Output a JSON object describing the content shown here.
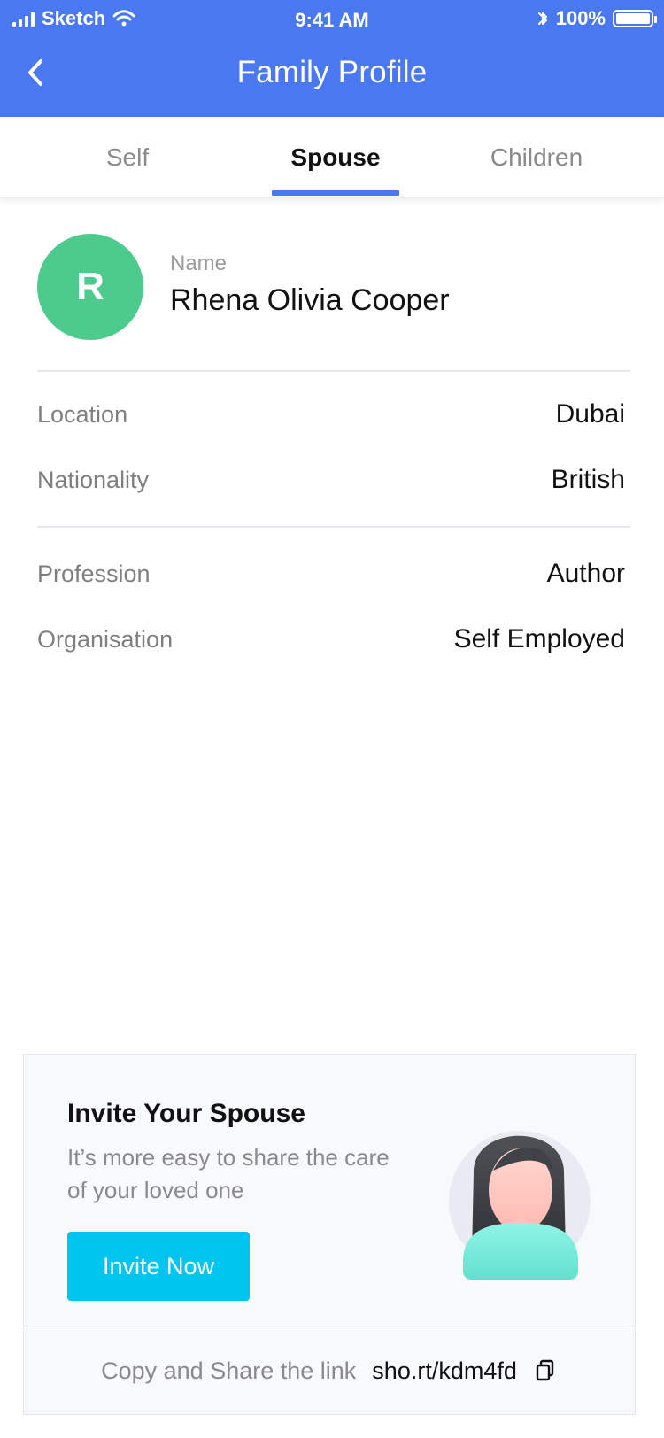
{
  "status_bar": {
    "carrier": "Sketch",
    "time": "9:41 AM",
    "battery": "100%"
  },
  "header": {
    "title": "Family Profile",
    "back_icon": "chevron-left-icon"
  },
  "tabs": [
    {
      "label": "Self"
    },
    {
      "label": "Spouse"
    },
    {
      "label": "Children"
    }
  ],
  "profile": {
    "avatar_initial": "R",
    "name_label": "Name",
    "name_value": "Rhena Olivia Cooper"
  },
  "details": [
    {
      "label": "Location",
      "value": "Dubai"
    },
    {
      "label": "Nationality",
      "value": "British"
    },
    {
      "label": "Profession",
      "value": "Author"
    },
    {
      "label": "Organisation",
      "value": "Self Employed"
    }
  ],
  "invite": {
    "title": "Invite Your Spouse",
    "subtitle": "It’s more easy to share the care of your loved one",
    "button_label": "Invite Now",
    "share_label": "Copy and Share the link",
    "share_link": "sho.rt/kdm4fd"
  },
  "colors": {
    "primary": "#4A78F0",
    "avatar": "#4CCB8D",
    "invite_button": "#00C5EF"
  }
}
